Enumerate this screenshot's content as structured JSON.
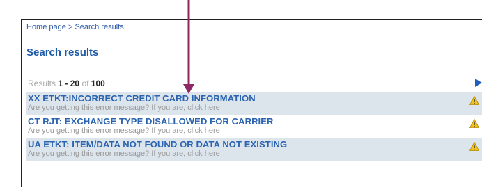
{
  "breadcrumb": {
    "home": "Home page",
    "separator": ">",
    "current": "Search results"
  },
  "page_title": "Search results",
  "summary": {
    "prefix": "Results",
    "from": "1",
    "dash": "-",
    "to": "20",
    "of_label": "of",
    "total": "100"
  },
  "results": [
    {
      "title": "XX ETKT:INCORRECT CREDIT CARD INFORMATION",
      "subtitle": "Are you getting this error message? If you are, click here"
    },
    {
      "title": "CT RJT: EXCHANGE TYPE DISALLOWED FOR CARRIER",
      "subtitle": "Are you getting this error message? If you are, click here"
    },
    {
      "title": "UA ETKT: ITEM/DATA NOT FOUND OR DATA NOT EXISTING",
      "subtitle": "Are you getting this error message? If you are, click here"
    }
  ],
  "icons": {
    "next_page": "next-page-arrow-icon",
    "row_status": "warning-triangle-icon",
    "annotation": "annotation-pointer-arrow"
  },
  "colors": {
    "link_blue": "#2a64b0",
    "row_shade": "#dce4ec",
    "warning_yellow": "#f2c21b",
    "annotation": "#8e2a63"
  }
}
